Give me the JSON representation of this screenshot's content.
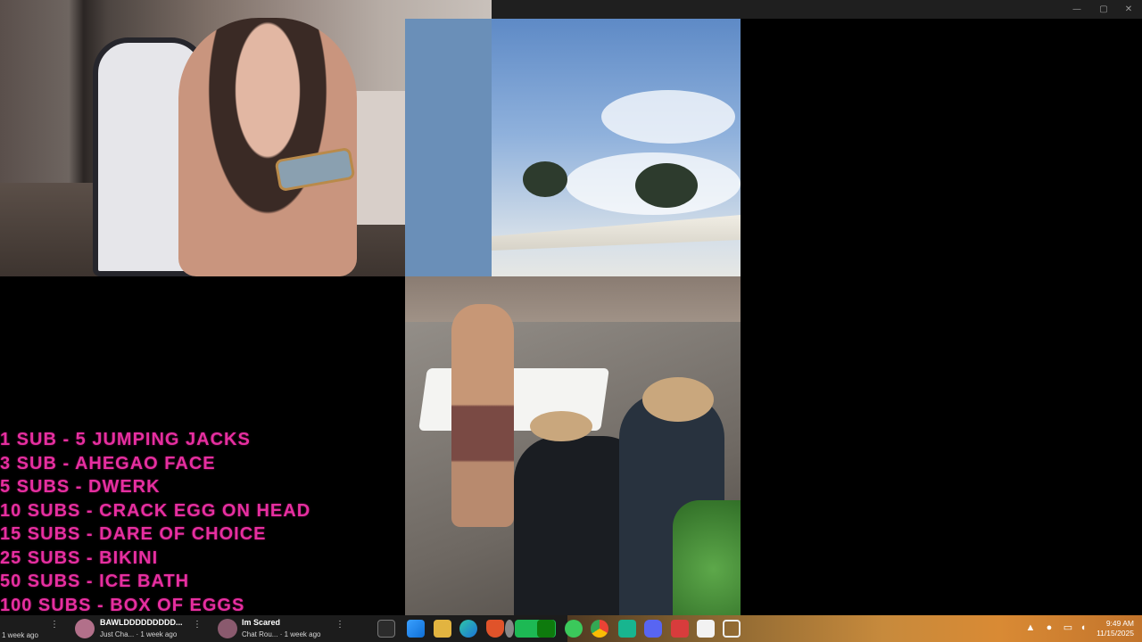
{
  "window_controls": {
    "minimize": "—",
    "maximize": "▢",
    "close": "✕"
  },
  "overlay": {
    "sub_goals": [
      "1 SUB - 5 JUMPING JACKS",
      "3 SUB - AHEGAO FACE",
      "5 SUBS - DWERK",
      "10 SUBS - CRACK EGG ON HEAD",
      "15 SUBS - DARE OF CHOICE",
      "25 SUBS - BIKINI",
      "50 SUBS - ICE BATH",
      "100 SUBS - BOX OF EGGS"
    ]
  },
  "video_cards": [
    {
      "title": "",
      "subtitle": "1 week ago",
      "more": "⋮"
    },
    {
      "title": "BAWLDDDDDDDDD...",
      "subtitle": "Just Cha...  · 1 week ago",
      "more": "⋮"
    },
    {
      "title": "Im Scared",
      "subtitle": "Chat Rou...  · 1 week ago",
      "more": "⋮"
    }
  ],
  "taskbar": {
    "pinned_icons": [
      "files-icon",
      "windows-start-icon",
      "file-explorer-icon",
      "edge-icon",
      "brave-icon",
      "settings-icon",
      "spotify-icon",
      "xbox-icon",
      "app-green-icon",
      "chrome-icon",
      "app-teal-icon",
      "discord-icon",
      "app-red-icon",
      "calendar-icon",
      "photos-icon"
    ],
    "tray_icons": [
      "chevron-up-icon",
      "microphone-icon",
      "display-icon",
      "volume-icon"
    ],
    "time": "9:49 AM",
    "date": "11/15/2025"
  },
  "colors": {
    "sub_goal_text": "#e62fa0",
    "taskbar": "#1c1c1c"
  }
}
